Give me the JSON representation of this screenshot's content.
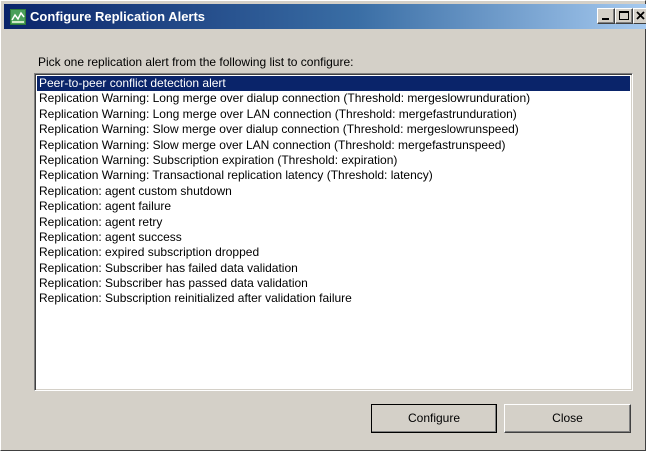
{
  "window": {
    "title": "Configure Replication Alerts"
  },
  "titlebar_buttons": {
    "minimize_icon": "minimize-icon",
    "maximize_icon": "maximize-icon",
    "close_icon": "close-icon"
  },
  "prompt": "Pick one replication alert from the following list to configure:",
  "alerts": [
    "Peer-to-peer conflict detection alert",
    "Replication Warning: Long merge over dialup connection (Threshold: mergeslowrunduration)",
    "Replication Warning: Long merge over LAN connection (Threshold: mergefastrunduration)",
    "Replication Warning: Slow merge over dialup connection (Threshold: mergeslowrunspeed)",
    "Replication Warning: Slow merge over LAN connection (Threshold: mergefastrunspeed)",
    "Replication Warning: Subscription expiration (Threshold: expiration)",
    "Replication Warning: Transactional replication latency (Threshold: latency)",
    "Replication: agent custom shutdown",
    "Replication: agent failure",
    "Replication: agent retry",
    "Replication: agent success",
    "Replication: expired subscription dropped",
    "Replication: Subscriber has failed data validation",
    "Replication: Subscriber has passed data validation",
    "Replication: Subscription reinitialized after validation failure"
  ],
  "selected_index": 0,
  "buttons": {
    "configure": "Configure",
    "close": "Close"
  },
  "colors": {
    "selection": "#0a246a",
    "titlebar_start": "#0a246a",
    "titlebar_end": "#a6caf0",
    "dialog_face": "#d4d0c8"
  }
}
